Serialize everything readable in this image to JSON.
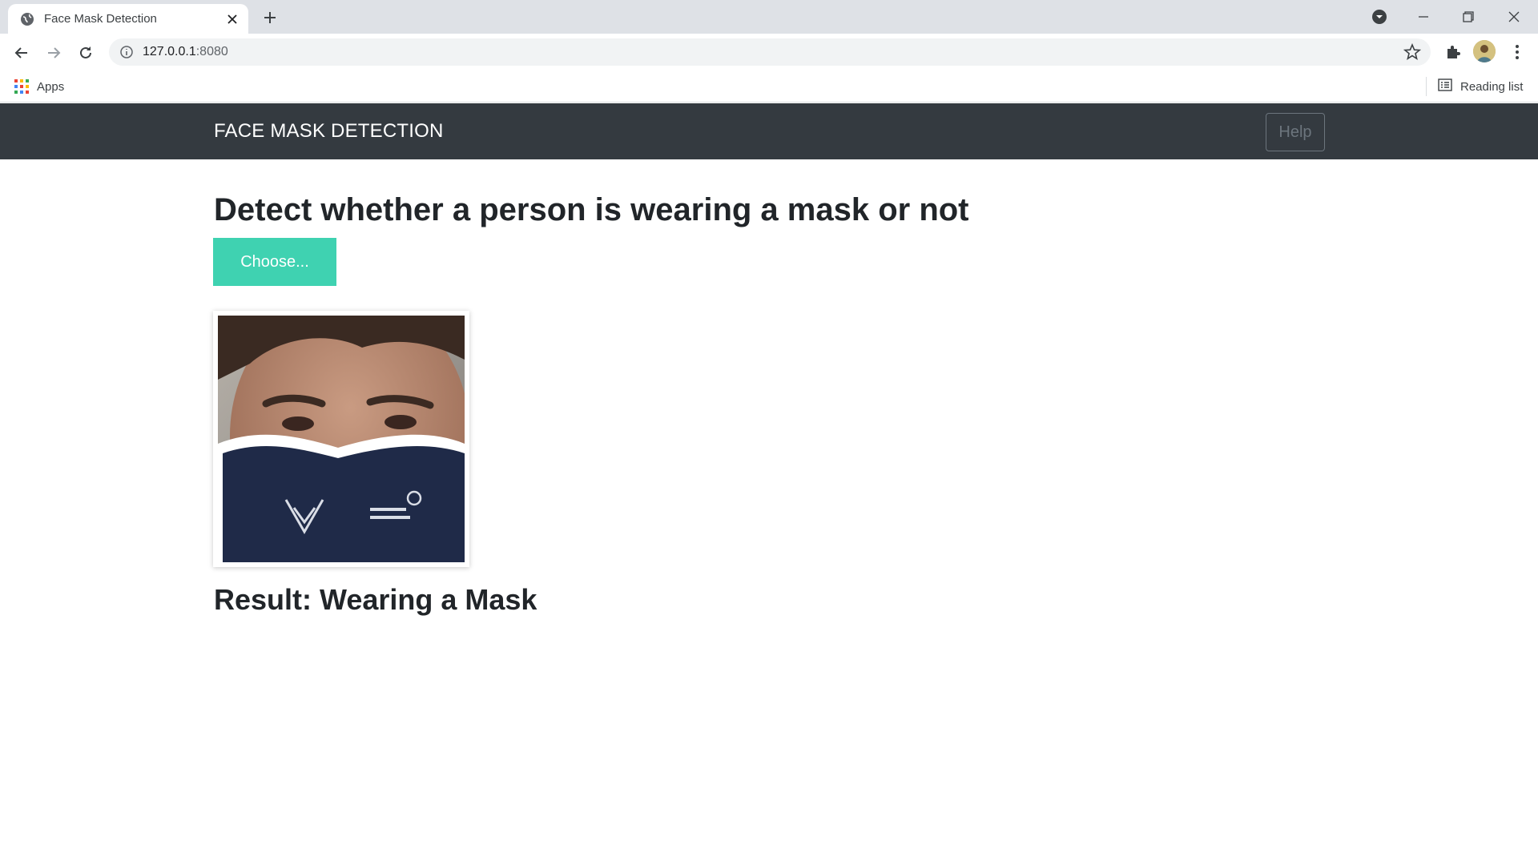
{
  "browser": {
    "tab_title": "Face Mask Detection",
    "url_host": "127.0.0.1",
    "url_port": ":8080",
    "bookmarks": {
      "apps_label": "Apps",
      "reading_list_label": "Reading list"
    },
    "icons": [
      "globe-icon",
      "close-icon",
      "plus-icon",
      "profile-dropdown-icon",
      "minimize-icon",
      "restore-icon",
      "window-close-icon",
      "back-icon",
      "forward-icon",
      "reload-icon",
      "info-icon",
      "star-icon",
      "puzzle-icon",
      "kebab-menu-icon",
      "apps-grid-icon",
      "reading-list-icon"
    ]
  },
  "navbar": {
    "brand": "FACE MASK DETECTION",
    "help_label": "Help"
  },
  "main": {
    "heading": "Detect whether a person is wearing a mask or not",
    "choose_label": "Choose...",
    "image_alt": "Uploaded face photo",
    "result": "Result: Wearing a Mask"
  },
  "colors": {
    "navbar_bg": "#343a40",
    "choose_button": "#3fd2b1",
    "help_border": "#6c757d"
  }
}
